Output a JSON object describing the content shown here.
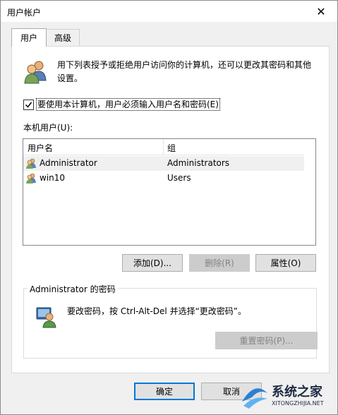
{
  "window": {
    "title": "用户帐户",
    "close_glyph": "✕"
  },
  "tabs": [
    {
      "label": "用户",
      "active": true
    },
    {
      "label": "高级",
      "active": false
    }
  ],
  "panel": {
    "description": "用下列表授予或拒绝用户访问你的计算机，还可以更改其密码和其他设置。",
    "must_login_checkbox": {
      "label": "要使用本计算机，用户必须输入用户名和密码(E)",
      "checked": true
    },
    "list_label": "本机用户(U):",
    "columns": {
      "username": "用户名",
      "group": "组"
    },
    "users": [
      {
        "name": "Administrator",
        "group": "Administrators",
        "selected": true
      },
      {
        "name": "win10",
        "group": "Users",
        "selected": false
      }
    ],
    "buttons": {
      "add": "添加(D)...",
      "remove": "删除(R)",
      "properties": "属性(O)"
    },
    "password_group": {
      "title": "Administrator 的密码",
      "instruction": "要改密码，按 Ctrl-Alt-Del 并选择“更改密码”。",
      "reset_button": "重置密码(P)..."
    }
  },
  "footer": {
    "ok": "确定",
    "cancel": "取消"
  },
  "watermark": {
    "text": "系统之家",
    "sub": "XITONGZHIJIA.NET"
  },
  "icons": [
    "users-icon",
    "user-icon",
    "password-icon",
    "close-icon",
    "check-icon"
  ],
  "colors": {
    "accent": "#0078d7",
    "window_bg": "#f0f0f0",
    "panel_bg": "#ffffff",
    "disabled_bg": "#cccccc"
  }
}
